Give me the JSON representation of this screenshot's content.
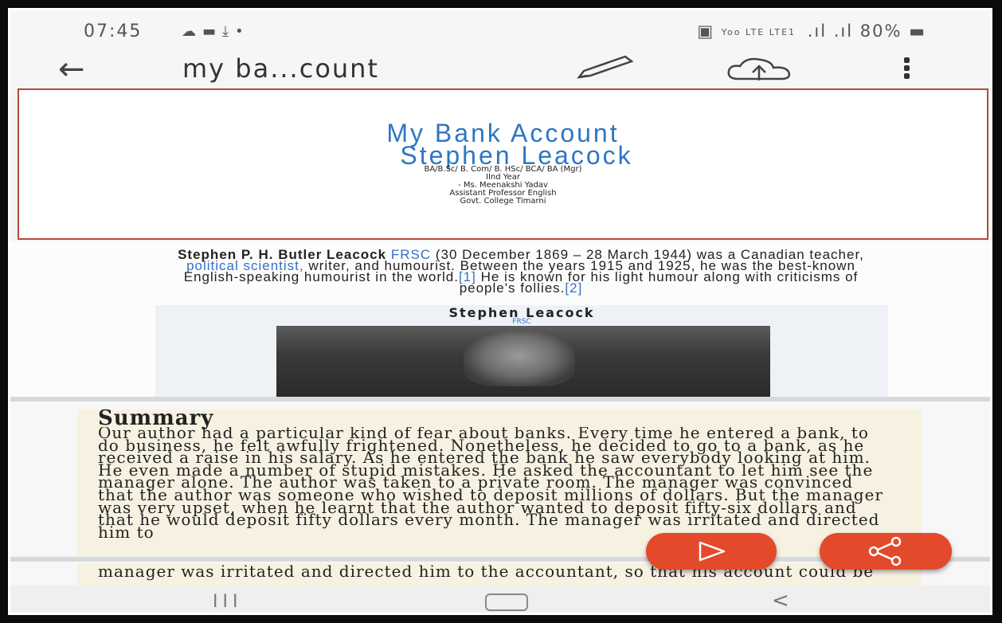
{
  "status_bar": {
    "time": "07:45",
    "carrier": "Yoo LTE LTE1",
    "battery": "80%"
  },
  "app_bar": {
    "title": "my ba...count"
  },
  "title_slide": {
    "title_line1": "My Bank Account",
    "title_line2": "Stephen Leacock",
    "meta": [
      "BA/B.Sc/ B. Com/ B. HSc/ BCA/ BA (Mgr)",
      "IInd Year",
      "- Ms. Meenakshi Yadav",
      "Assistant Professor English",
      "Govt. College Timarni"
    ]
  },
  "bio_slide": {
    "bio_part1": "Stephen P. H. Butler Leacock",
    "bio_link1": "FRSC",
    "bio_part2": "(30 December 1869 – 28 March 1944) was a Canadian teacher,",
    "bio_link2": "political scientist,",
    "bio_part3": "writer, and humourist. Between the years 1915 and 1925, he was the best-known English-speaking humourist in the world.",
    "bio_ref1": "[1]",
    "bio_part4": "He is known for his light humour along with criticisms of people's follies.",
    "bio_ref2": "[2]",
    "infobox_title": "Stephen Leacock",
    "infobox_subtitle": "FRSC"
  },
  "summary_slide": {
    "heading": "Summary",
    "body": "Our author had a particular kind of fear about banks. Every time he entered a bank, to do business, he felt awfully frightened. Nonetheless, he decided to go to a bank, as he received a raise in his salary. As he entered the bank he saw everybody looking at him. He even made a number of stupid mistakes. He asked the accountant to let him see the manager alone. The author was taken to a private room. The manager was convinced that the author was someone who wished to deposit millions of dollars. But the manager was very upset, when he learnt that the author wanted to deposit fifty-six dollars and that he would deposit fifty dollars every month. The manager was irritated and directed him to"
  },
  "next_slide": {
    "body": "manager was irritated and directed him to the accountant, so that his account could be"
  }
}
